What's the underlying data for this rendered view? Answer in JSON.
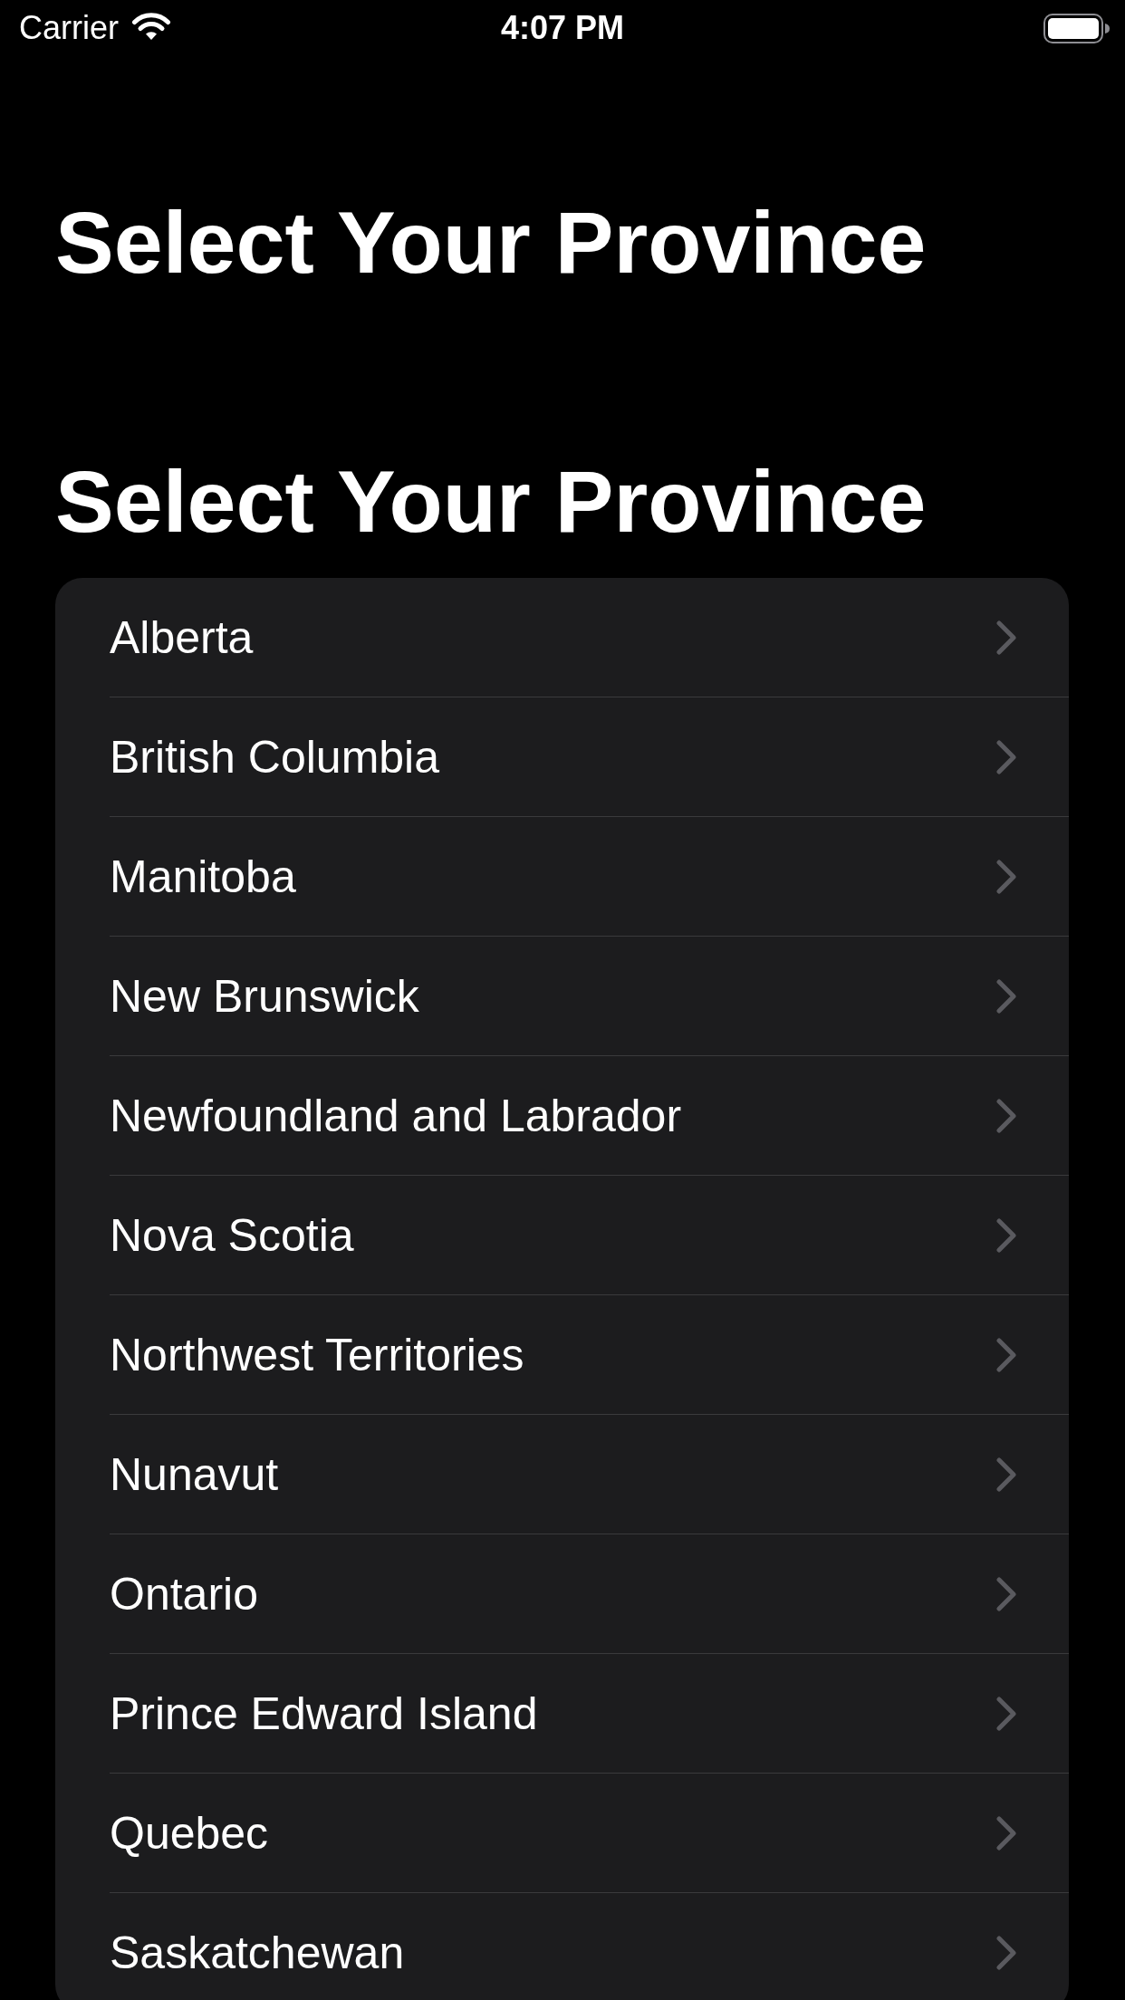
{
  "status_bar": {
    "carrier": "Carrier",
    "time": "4:07 PM"
  },
  "navigation_bar": {
    "large_title": "Select Your Province"
  },
  "list": {
    "title": "Select Your Province",
    "items": [
      {
        "label": "Alberta"
      },
      {
        "label": "British Columbia"
      },
      {
        "label": "Manitoba"
      },
      {
        "label": "New Brunswick"
      },
      {
        "label": "Newfoundland and Labrador"
      },
      {
        "label": "Nova Scotia"
      },
      {
        "label": "Northwest Territories"
      },
      {
        "label": "Nunavut"
      },
      {
        "label": "Ontario"
      },
      {
        "label": "Prince Edward Island"
      },
      {
        "label": "Quebec"
      },
      {
        "label": "Saskatchewan"
      }
    ]
  }
}
